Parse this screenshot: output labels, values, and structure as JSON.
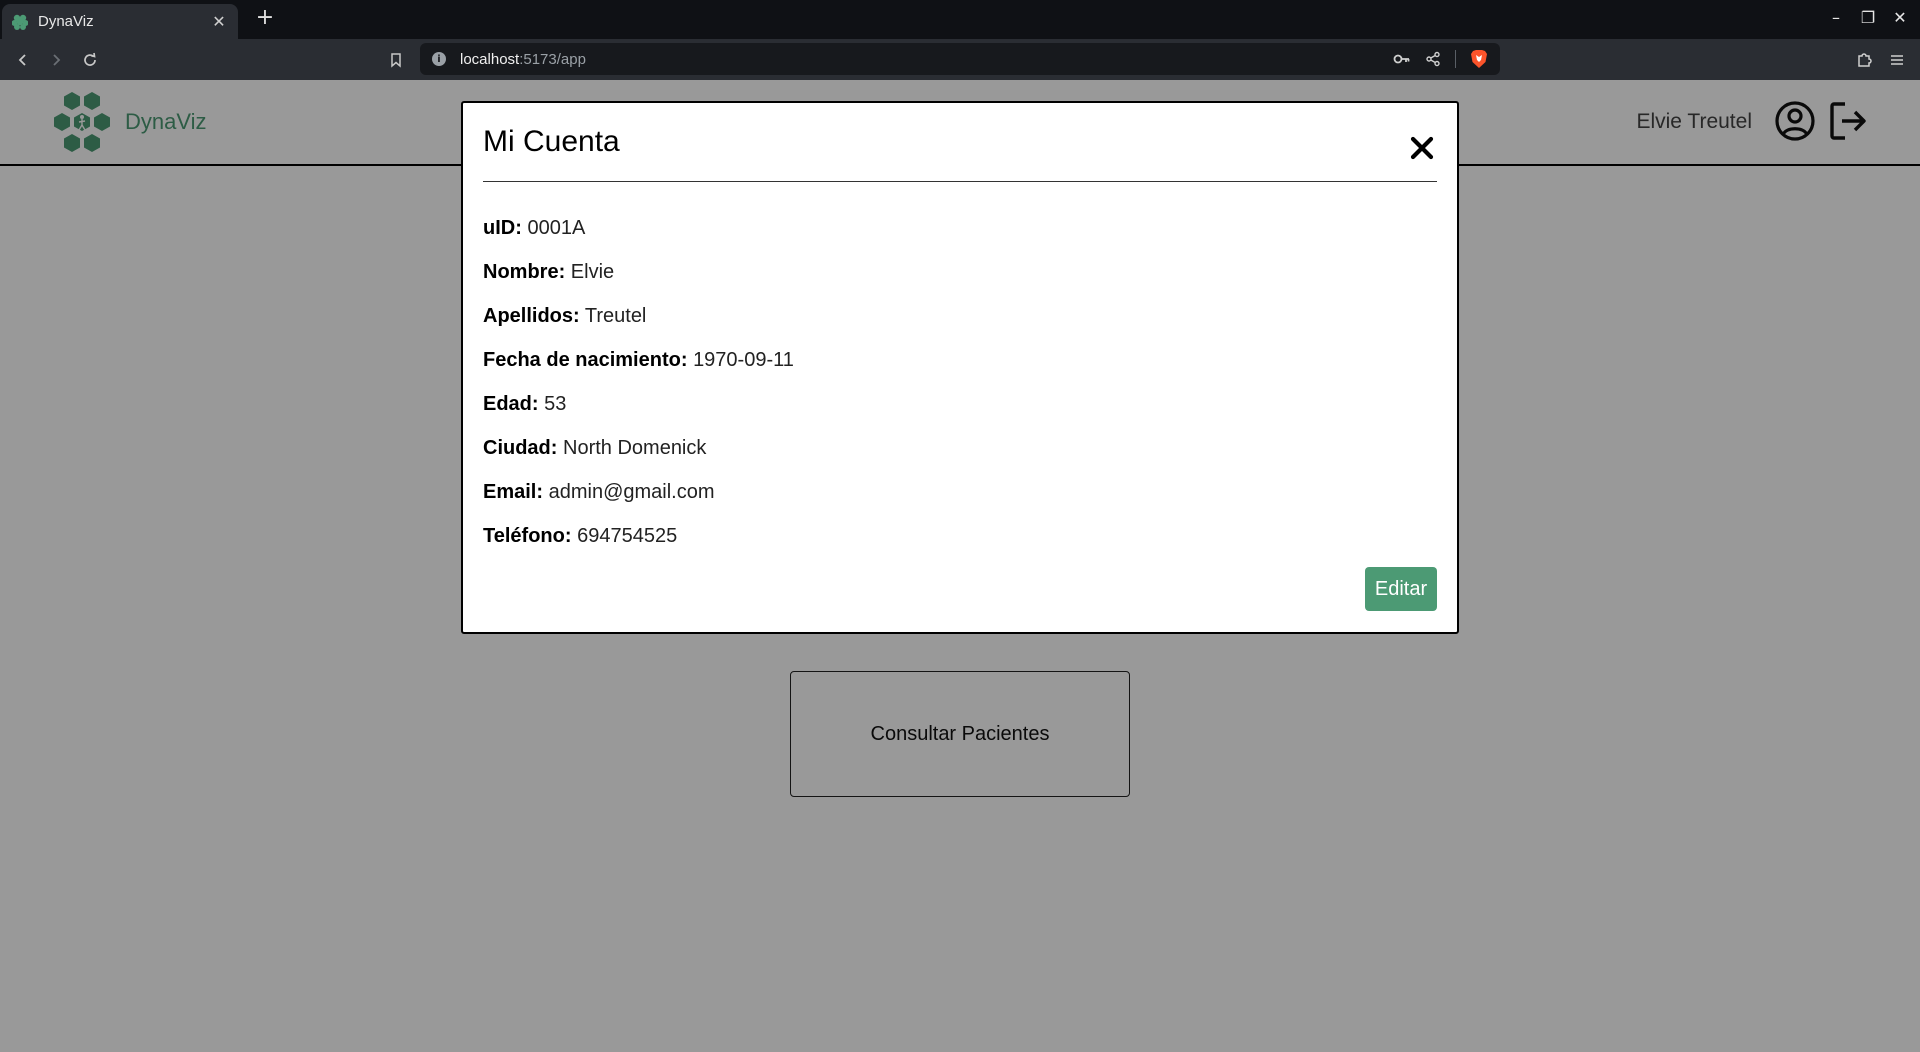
{
  "browser": {
    "tab_title": "DynaViz",
    "tab_close": "✕",
    "new_tab": "+",
    "url_host": "localhost",
    "url_path": ":5173/app",
    "controls": {
      "minimize": "–",
      "maximize": "❐",
      "close": "✕"
    }
  },
  "header": {
    "brand": "DynaViz",
    "user_name": "Elvie Treutel"
  },
  "cards": {
    "consultar": "Consultar Pacientes"
  },
  "modal": {
    "title": "Mi Cuenta",
    "fields": [
      {
        "label": "uID:",
        "value": "0001A"
      },
      {
        "label": "Nombre:",
        "value": "Elvie"
      },
      {
        "label": "Apellidos:",
        "value": "Treutel"
      },
      {
        "label": "Fecha de nacimiento:",
        "value": "1970-09-11"
      },
      {
        "label": "Edad:",
        "value": "53"
      },
      {
        "label": "Ciudad:",
        "value": "North Domenick"
      },
      {
        "label": "Email:",
        "value": "admin@gmail.com"
      },
      {
        "label": "Teléfono:",
        "value": "694754525"
      }
    ],
    "edit_label": "Editar"
  },
  "colors": {
    "accent": "#4c9a74",
    "overlay": "rgba(0,0,0,0.4)"
  }
}
